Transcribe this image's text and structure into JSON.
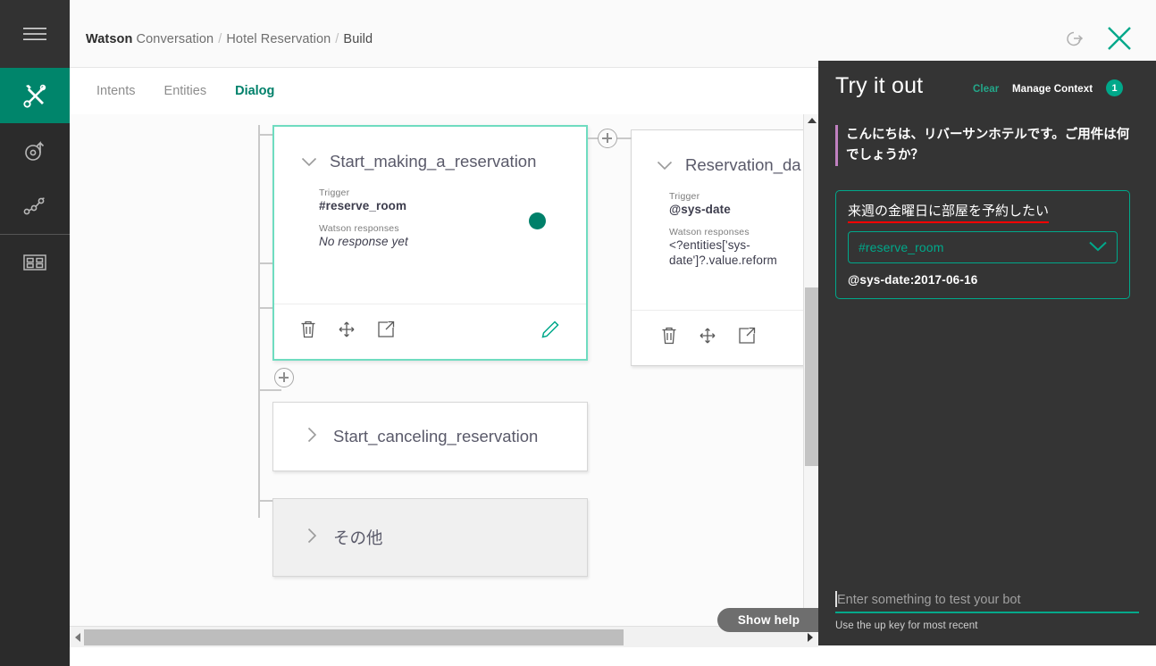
{
  "rail": {
    "items": [
      {
        "name": "hamburger-menu",
        "icon": "hamburger-icon"
      },
      {
        "name": "build-tools",
        "icon": "tools-icon",
        "active": true
      },
      {
        "name": "deploy",
        "icon": "deploy-icon"
      },
      {
        "name": "improve",
        "icon": "analytics-icon"
      },
      {
        "name": "workspaces",
        "icon": "grid-icon"
      }
    ]
  },
  "header": {
    "breadcrumb": {
      "product_bold": "Watson",
      "product_rest": " Conversation",
      "sep": "/",
      "workspace": "Hotel Reservation",
      "section": "Build"
    },
    "icons": {
      "exit": "exit-icon",
      "close": "close-icon"
    }
  },
  "tabs": [
    {
      "label": "Intents",
      "active": false
    },
    {
      "label": "Entities",
      "active": false
    },
    {
      "label": "Dialog",
      "active": true
    }
  ],
  "dialog_nodes": [
    {
      "title": "Start_making_a_reservation",
      "expanded": true,
      "selected": true,
      "trigger_label": "Trigger",
      "trigger_value": "#reserve_room",
      "responses_label": "Watson responses",
      "responses_value": "No response yet",
      "has_status_dot": true,
      "has_edit": true,
      "footer_icons": [
        "trash-icon",
        "move-icon",
        "jump-to-icon",
        "edit-pencil-icon"
      ]
    },
    {
      "title": "Reservation_da",
      "expanded": true,
      "selected": false,
      "trigger_label": "Trigger",
      "trigger_value": "@sys-date",
      "responses_label": "Watson responses",
      "responses_value": "<?entities['sys-date']?.value.reform",
      "has_status_dot": false,
      "has_edit": false,
      "footer_icons": [
        "trash-icon",
        "move-icon",
        "jump-to-icon"
      ]
    },
    {
      "title": "Start_canceling_reservation",
      "expanded": false,
      "style": "white"
    },
    {
      "title": "その他",
      "expanded": false,
      "style": "grey"
    }
  ],
  "canvas": {
    "add_node_label": "add-node",
    "show_help": "Show help"
  },
  "tryit": {
    "title": "Try it out",
    "clear": "Clear",
    "manage_context": "Manage Context",
    "context_count": "1",
    "bot_message": "こんにちは、リバーサンホテルです。ご用件は何でしょうか？",
    "user_message": "来週の金曜日に部屋を予約したい",
    "intent": "#reserve_room",
    "entity": "@sys-date:2017-06-16",
    "input_value": "",
    "input_placeholder": "Enter something to test your bot",
    "hint": "Use the up key for most recent"
  },
  "colors": {
    "accent_teal": "#00a88a",
    "rail_active": "#00856b",
    "panel_bg": "#343434",
    "annotation_red": "#ff0000",
    "node_selected_border": "#6fdcc0"
  }
}
